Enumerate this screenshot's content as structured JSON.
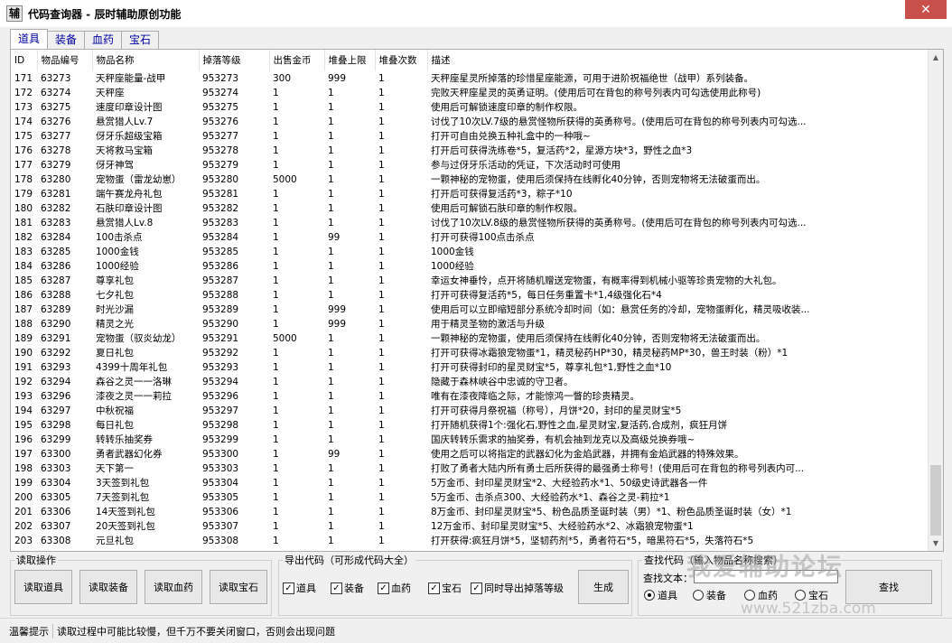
{
  "window": {
    "icon_text": "辅",
    "title": "代码查询器 - 辰时辅助原创功能",
    "close": "✕"
  },
  "tabs": [
    "道具",
    "装备",
    "血药",
    "宝石"
  ],
  "table": {
    "columns": [
      "ID",
      "物品编号",
      "物品名称",
      "掉落等级",
      "出售金币",
      "堆叠上限",
      "堆叠次数",
      "描述"
    ],
    "rows": [
      [
        "171",
        "63273",
        "天秤座能量-战甲",
        "953273",
        "300",
        "999",
        "1",
        "天秤座星灵所掉落的珍惜星座能源，可用于进阶祝福绝世（战甲）系列装备。"
      ],
      [
        "172",
        "63274",
        "天秤座",
        "953274",
        "1",
        "1",
        "1",
        "完败天秤座星灵的英勇证明。(使用后可在背包的称号列表内可勾选使用此称号)"
      ],
      [
        "173",
        "63275",
        "速度印章设计图",
        "953275",
        "1",
        "1",
        "1",
        "使用后可解锁速度印章的制作权限。"
      ],
      [
        "174",
        "63276",
        "悬赏猎人Lv.7",
        "953276",
        "1",
        "1",
        "1",
        "讨伐了10次LV.7级的悬赏怪物所获得的英勇称号。(使用后可在背包的称号列表内可勾选..."
      ],
      [
        "175",
        "63277",
        "伢牙乐超级宝箱",
        "953277",
        "1",
        "1",
        "1",
        "打开可自由兑换五种礼盒中的一种哦~"
      ],
      [
        "176",
        "63278",
        "天将救马宝箱",
        "953278",
        "1",
        "1",
        "1",
        "打开后可获得洗练卷*5，复活药*2，星源方块*3，野性之血*3"
      ],
      [
        "177",
        "63279",
        "伢牙神驾",
        "953279",
        "1",
        "1",
        "1",
        "参与过伢牙乐活动的凭证，下次活动时可使用"
      ],
      [
        "178",
        "63280",
        "宠物蛋（雷龙幼崽）",
        "953280",
        "5000",
        "1",
        "1",
        "一颗神秘的宠物蛋，使用后须保持在线孵化40分钟，否则宠物将无法破蛋而出。"
      ],
      [
        "179",
        "63281",
        "端午赛龙舟礼包",
        "953281",
        "1",
        "1",
        "1",
        "打开后可获得复活药*3，粽子*10"
      ],
      [
        "180",
        "63282",
        "石肤印章设计图",
        "953282",
        "1",
        "1",
        "1",
        "使用后可解锁石肤印章的制作权限。"
      ],
      [
        "181",
        "63283",
        "悬赏猎人Lv.8",
        "953283",
        "1",
        "1",
        "1",
        "讨伐了10次LV.8级的悬赏怪物所获得的英勇称号。(使用后可在背包的称号列表内可勾选..."
      ],
      [
        "182",
        "63284",
        "100击杀点",
        "953284",
        "1",
        "99",
        "1",
        "打开可获得100点击杀点"
      ],
      [
        "183",
        "63285",
        "1000金钱",
        "953285",
        "1",
        "1",
        "1",
        "1000金钱"
      ],
      [
        "184",
        "63286",
        "1000经验",
        "953286",
        "1",
        "1",
        "1",
        "1000经验"
      ],
      [
        "185",
        "63287",
        "尊享礼包",
        "953287",
        "1",
        "1",
        "1",
        "幸运女神垂怜，点开将随机赠送宠物蛋，有概率得到机械小驱等珍贵宠物的大礼包。"
      ],
      [
        "186",
        "63288",
        "七夕礼包",
        "953288",
        "1",
        "1",
        "1",
        "打开可获得复活药*5，每日任务重置卡*1,4级强化石*4"
      ],
      [
        "187",
        "63289",
        "时光沙漏",
        "953289",
        "1",
        "999",
        "1",
        "使用后可以立即缩短部分系统冷却时间（如：悬赏任务的冷却，宠物蛋孵化，精灵吸收装..."
      ],
      [
        "188",
        "63290",
        "精灵之光",
        "953290",
        "1",
        "999",
        "1",
        "用于精灵圣物的激活与升级"
      ],
      [
        "189",
        "63291",
        "宠物蛋（驭炎幼龙）",
        "953291",
        "5000",
        "1",
        "1",
        "一颗神秘的宠物蛋，使用后须保持在线孵化40分钟，否则宠物将无法破蛋而出。"
      ],
      [
        "190",
        "63292",
        "夏日礼包",
        "953292",
        "1",
        "1",
        "1",
        "打开可获得冰霜狼宠物蛋*1，精灵秘药HP*30，精灵秘药MP*30，兽王时装（粉）*1"
      ],
      [
        "191",
        "63293",
        "4399十周年礼包",
        "953293",
        "1",
        "1",
        "1",
        "打开可获得封印的星灵财宝*5，尊享礼包*1,野性之血*10"
      ],
      [
        "192",
        "63294",
        "森谷之灵一一洛琳",
        "953294",
        "1",
        "1",
        "1",
        "隐藏于森林峡谷中忠诚的守卫者。"
      ],
      [
        "193",
        "63296",
        "漆夜之灵一一莉拉",
        "953296",
        "1",
        "1",
        "1",
        "唯有在漆夜降临之际，才能惊鸿一瞥的珍贵精灵。"
      ],
      [
        "194",
        "63297",
        "中秋祝福",
        "953297",
        "1",
        "1",
        "1",
        "打开可获得月祭祝福（称号），月饼*20，封印的星灵财宝*5"
      ],
      [
        "195",
        "63298",
        "每日礼包",
        "953298",
        "1",
        "1",
        "1",
        "打开随机获得1个:强化石,野性之血,星灵财宝,复活药,合成剂，疯狂月饼"
      ],
      [
        "196",
        "63299",
        "转转乐抽奖券",
        "953299",
        "1",
        "1",
        "1",
        "国庆转转乐需求的抽奖券，有机会抽到龙克以及高级兑换券哦~"
      ],
      [
        "197",
        "63300",
        "勇者武器幻化券",
        "953300",
        "1",
        "99",
        "1",
        "使用之后可以将指定的武器幻化为金焰武器，并拥有金焰武器的特殊效果。"
      ],
      [
        "198",
        "63303",
        "天下第一",
        "953303",
        "1",
        "1",
        "1",
        "打败了勇者大陆内所有勇士后所获得的最强勇士称号！(使用后可在背包的称号列表内可..."
      ],
      [
        "199",
        "63304",
        "3天签到礼包",
        "953304",
        "1",
        "1",
        "1",
        "5万金币、封印星灵财宝*2、大经验药水*1、50级史诗武器各一件"
      ],
      [
        "200",
        "63305",
        "7天签到礼包",
        "953305",
        "1",
        "1",
        "1",
        "5万金币、击杀点300、大经验药水*1、森谷之灵-莉拉*1"
      ],
      [
        "201",
        "63306",
        "14天签到礼包",
        "953306",
        "1",
        "1",
        "1",
        "8万金币、封印星灵财宝*5、粉色品质圣诞时装（男）*1、粉色品质圣诞时装（女）*1"
      ],
      [
        "202",
        "63307",
        "20天签到礼包",
        "953307",
        "1",
        "1",
        "1",
        "12万金币、封印星灵财宝*5、大经验药水*2、冰霜狼宠物蛋*1"
      ],
      [
        "203",
        "63308",
        "元旦礼包",
        "953308",
        "1",
        "1",
        "1",
        "打开获得:疯狂月饼*5，坚韧药剂*5，勇者符石*5，暗黑符石*5，失落符石*5"
      ]
    ]
  },
  "read_group": {
    "legend": "读取操作",
    "buttons": [
      "读取道具",
      "读取装备",
      "读取血药",
      "读取宝石"
    ]
  },
  "export_group": {
    "legend": "导出代码（可形成代码大全）",
    "checks": [
      {
        "label": "道具",
        "checked": true
      },
      {
        "label": "装备",
        "checked": true
      },
      {
        "label": "血药",
        "checked": true
      },
      {
        "label": "宝石",
        "checked": true
      },
      {
        "label": "同时导出掉落等级",
        "checked": true
      }
    ],
    "generate": "生成"
  },
  "search_group": {
    "legend": "查找代码（输入物品名称搜索）",
    "label": "查找文本：",
    "value": "",
    "radios": [
      {
        "label": "道具",
        "selected": true
      },
      {
        "label": "装备",
        "selected": false
      },
      {
        "label": "血药",
        "selected": false
      },
      {
        "label": "宝石",
        "selected": false
      }
    ],
    "search": "查找"
  },
  "status": {
    "label": "温馨提示",
    "text": "读取过程中可能比较慢，但千万不要关闭窗口，否则会出现问题"
  },
  "watermark": {
    "line1": "我爱辅助论坛",
    "line2": "www.521zba.com"
  }
}
